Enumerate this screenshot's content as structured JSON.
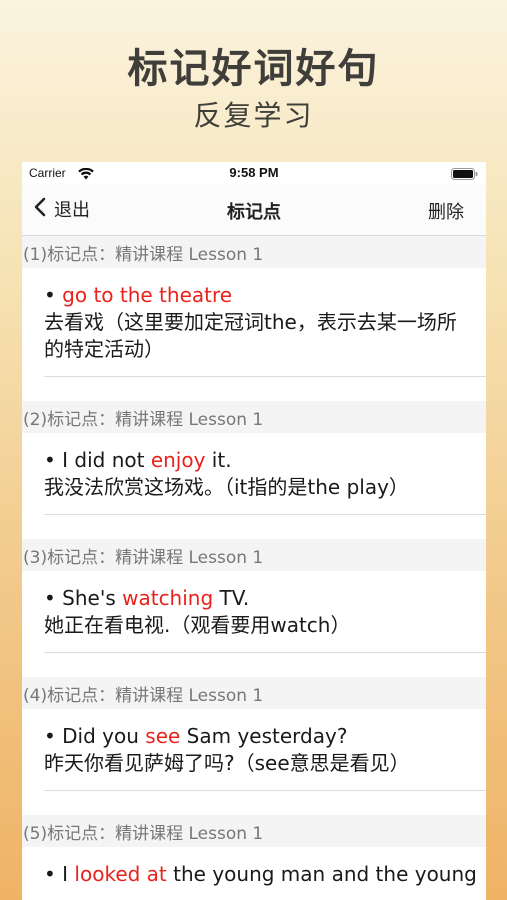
{
  "promo": {
    "title": "标记好词好句",
    "subtitle": "反复学习"
  },
  "status_bar": {
    "carrier": "Carrier",
    "time": "9:58 PM"
  },
  "nav": {
    "back_label": "退出",
    "title": "标记点",
    "delete_label": "删除"
  },
  "items": [
    {
      "header": "(1)标记点：精讲课程 Lesson 1",
      "bullet": "• ",
      "pre": "",
      "highlight": "go to the theatre",
      "post": "",
      "translation": "去看戏（这里要加定冠词the，表示去某一场所的特定活动）"
    },
    {
      "header": "(2)标记点：精讲课程 Lesson 1",
      "bullet": "• ",
      "pre": "I did not ",
      "highlight": "enjoy",
      "post": " it.",
      "translation": "我没法欣赏这场戏。（it指的是the play）"
    },
    {
      "header": "(3)标记点：精讲课程 Lesson 1",
      "bullet": "• ",
      "pre": "She's ",
      "highlight": "watching",
      "post": " TV.",
      "translation": "她正在看电视.（观看要用watch）"
    },
    {
      "header": "(4)标记点：精讲课程 Lesson 1",
      "bullet": "• ",
      "pre": "Did you ",
      "highlight": "see",
      "post": " Sam yesterday?",
      "translation": "昨天你看见萨姆了吗?（see意思是看见）"
    },
    {
      "header": "(5)标记点：精讲课程 Lesson 1",
      "bullet": "• ",
      "pre": "I ",
      "highlight": "looked at",
      "post": " the young man and the young",
      "translation": ""
    }
  ],
  "colors": {
    "highlight": "#e8231d",
    "background_top": "#fbf3df",
    "background_bottom": "#efb365"
  }
}
